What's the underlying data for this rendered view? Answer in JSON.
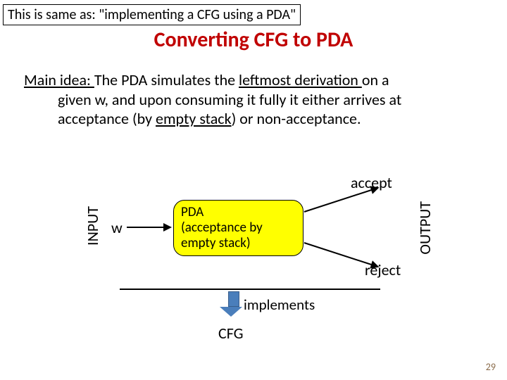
{
  "note": "This is same as: \"implementing a CFG using a PDA\"",
  "title": "Converting CFG to PDA",
  "main_idea": {
    "lead": "Main idea: ",
    "part1": "The PDA simulates the ",
    "u1": "leftmost derivation ",
    "part2": "on a",
    "line2a": "given w, and upon consuming it fully it either arrives at",
    "line3a": "acceptance (by ",
    "u2": "empty stack",
    "line3b": ") or non-acceptance."
  },
  "diagram": {
    "input_label": "INPUT",
    "output_label": "OUTPUT",
    "w": "w",
    "pda_line1": "PDA",
    "pda_line2": "(acceptance by",
    "pda_line3": "empty stack)",
    "accept": "accept",
    "reject": "reject",
    "implements": "implements",
    "cfg": "CFG"
  },
  "page_number": "29"
}
